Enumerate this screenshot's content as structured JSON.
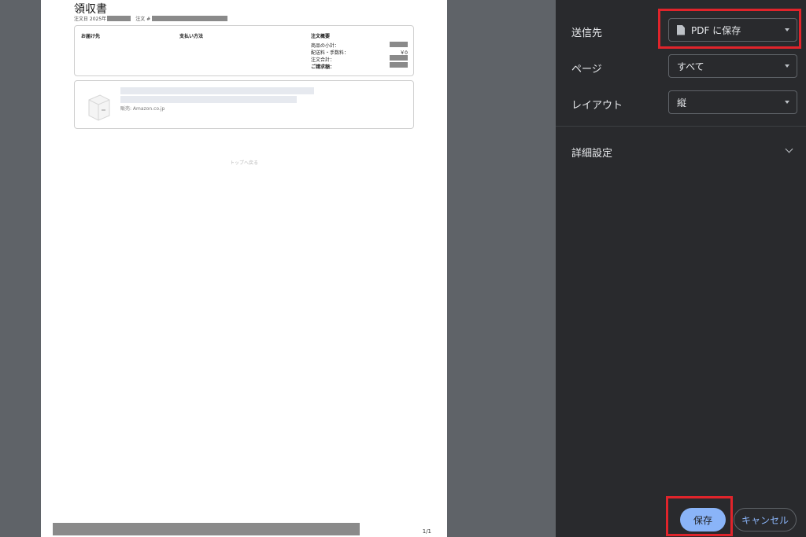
{
  "preview": {
    "title": "領収書",
    "order_date_label": "注文日 2025年",
    "order_no_label": "注文 #",
    "col_ship_to": "お届け先",
    "col_payment": "支払い方法",
    "col_summary": "注文概要",
    "subtotal_label": "商品の小計：",
    "shipping_label": "配送料・手数料：",
    "shipping_value": "￥0",
    "total_label": "注文合計：",
    "billed_label": "ご請求額：",
    "seller_text": "販売: Amazon.co.jp",
    "back_to_top": "トップへ戻る",
    "page_number": "1/1"
  },
  "settings": {
    "destination_label": "送信先",
    "destination_value": "PDF に保存",
    "pages_label": "ページ",
    "pages_value": "すべて",
    "layout_label": "レイアウト",
    "layout_value": "縦",
    "more_settings_label": "詳細設定"
  },
  "actions": {
    "save_label": "保存",
    "cancel_label": "キャンセル"
  },
  "icons": {
    "destination": "document-icon",
    "dropdown": "caret-down-icon",
    "expand": "chevron-down-icon"
  },
  "colors": {
    "sidebar_bg": "#292a2d",
    "preview_bg": "#5f6368",
    "accent": "#8ab4f8",
    "highlight": "#e0242b"
  }
}
